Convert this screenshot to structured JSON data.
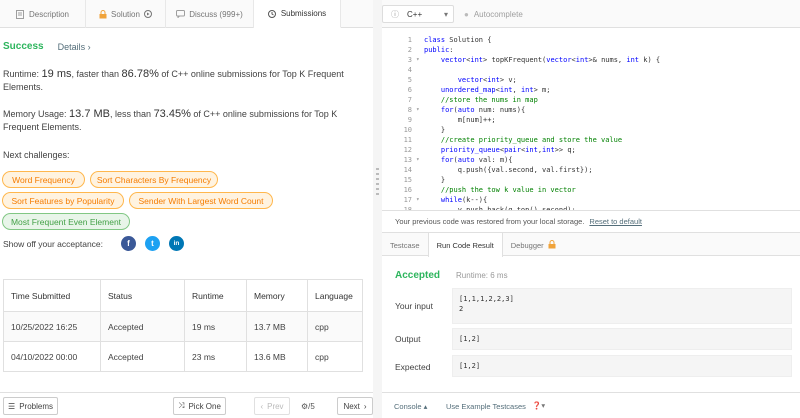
{
  "tabs": [
    {
      "label": "Description",
      "icon": "file-icon"
    },
    {
      "label": "Solution",
      "icon": "lock-icon"
    },
    {
      "label": "Discuss (999+)",
      "icon": "chat-icon"
    },
    {
      "label": "Submissions",
      "icon": "clock-icon"
    }
  ],
  "result": {
    "status": "Success",
    "details": "Details",
    "runtime_prefix": "Runtime:",
    "runtime_value": "19 ms",
    "runtime_mid": ", faster than",
    "runtime_pct": "86.78%",
    "runtime_suffix": "of C++ online submissions for Top K Frequent Elements.",
    "memory_prefix": "Memory Usage:",
    "memory_value": "13.7 MB",
    "memory_mid": ", less than",
    "memory_pct": "73.45%",
    "memory_suffix": "of C++ online submissions for Top K Frequent Elements."
  },
  "next_challenges_label": "Next challenges:",
  "challenges": [
    {
      "label": "Word Frequency",
      "difficulty": "medium"
    },
    {
      "label": "Sort Characters By Frequency",
      "difficulty": "medium"
    },
    {
      "label": "Sort Features by Popularity",
      "difficulty": "medium"
    },
    {
      "label": "Sender With Largest Word Count",
      "difficulty": "medium"
    },
    {
      "label": "Most Frequent Even Element",
      "difficulty": "easy"
    }
  ],
  "share_label": "Show off your acceptance:",
  "social": [
    {
      "name": "facebook-icon",
      "glyph": "f",
      "color": "#3b5998"
    },
    {
      "name": "twitter-icon",
      "glyph": "t",
      "color": "#1da1f2"
    },
    {
      "name": "linkedin-icon",
      "glyph": "in",
      "color": "#0077b5"
    }
  ],
  "table": {
    "headers": [
      "Time Submitted",
      "Status",
      "Runtime",
      "Memory",
      "Language"
    ],
    "rows": [
      [
        "10/25/2022 16:25",
        "Accepted",
        "19 ms",
        "13.7 MB",
        "cpp"
      ],
      [
        "04/10/2022 00:00",
        "Accepted",
        "23 ms",
        "13.6 MB",
        "cpp"
      ]
    ]
  },
  "bottom_left": {
    "problems": "Problems",
    "pick_one": "Pick One",
    "prev": "Prev",
    "page": "/5",
    "next": "Next"
  },
  "editor": {
    "language": "C++",
    "autocomplete": "Autocomplete",
    "lines": [
      "class Solution {",
      "public:",
      "    vector<int> topKFrequent(vector<int>& nums, int k) {",
      "",
      "        vector<int> v;",
      "    unordered_map<int, int> m;",
      "    //store the nums in map",
      "    for(auto num: nums){",
      "        m[num]++;",
      "    }",
      "    //create priority_queue and store the value",
      "    priority_queue<pair<int,int>> q;",
      "    for(auto val: m){",
      "        q.push({val.second, val.first});",
      "    }",
      "    //push the tow k value in vector",
      "    while(k--){",
      "        v.push_back(q.top().second);"
    ],
    "fold_lines": [
      3,
      8,
      13,
      17
    ]
  },
  "restore": {
    "text": "Your previous code was restored from your local storage.",
    "link": "Reset to default"
  },
  "result_tabs": [
    {
      "label": "Testcase"
    },
    {
      "label": "Run Code Result"
    },
    {
      "label": "Debugger"
    }
  ],
  "run_result": {
    "status": "Accepted",
    "runtime": "Runtime: 6 ms",
    "input_label": "Your input",
    "input_value": "[1,1,1,2,2,3]\n2",
    "output_label": "Output",
    "output_value": "[1,2]",
    "expected_label": "Expected",
    "expected_value": "[1,2]"
  },
  "bottom_right": {
    "console": "Console",
    "example": "Use Example Testcases"
  },
  "colors": {
    "accepted": "#2db55d",
    "medium": "#f57c00",
    "easy": "#43a047"
  }
}
